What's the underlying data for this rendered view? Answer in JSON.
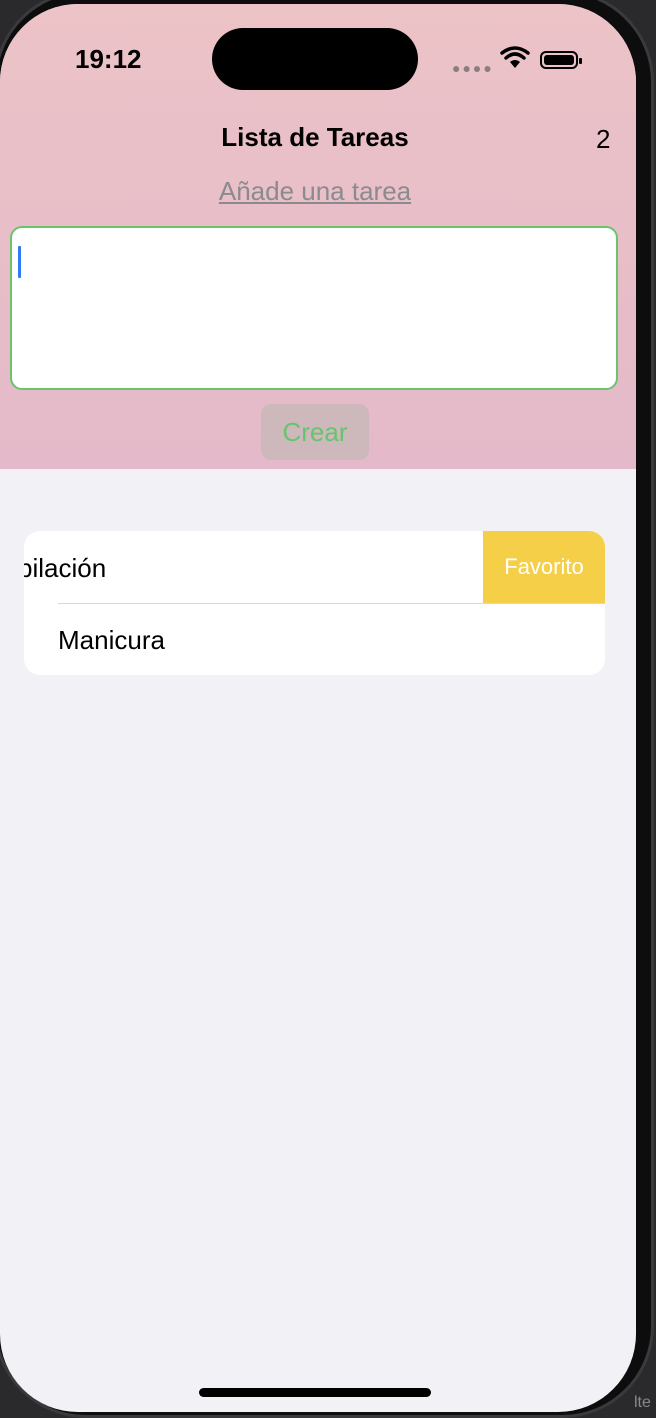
{
  "status_bar": {
    "time": "19:12"
  },
  "header": {
    "title": "Lista de Tareas",
    "count": "2",
    "add_link": "Añade una tarea",
    "create_button": "Crear"
  },
  "tasks": [
    {
      "label": "pilación",
      "swipe_action": "Favorito"
    },
    {
      "label": "Manicura"
    }
  ],
  "colors": {
    "header_top": "#ecc3c7",
    "header_bottom": "#e4b9c9",
    "accent_green": "#68c46c",
    "favorite_yellow": "#f6cf48",
    "caret_blue": "#2f7cf6"
  },
  "corner_text": "lte"
}
